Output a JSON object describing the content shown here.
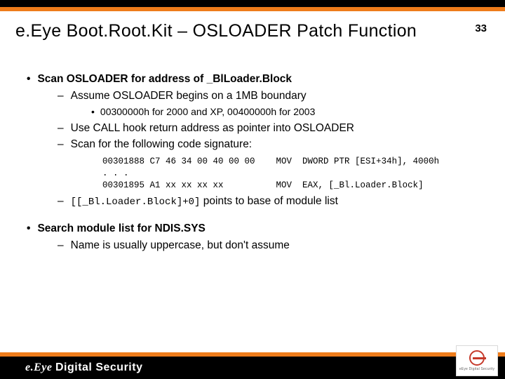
{
  "slide_number": "33",
  "title": "e.Eye Boot.Root.Kit – OSLOADER Patch Function",
  "bullets": {
    "b1a": "Scan OSLOADER for address of _BlLoader.Block",
    "b2a": "Assume OSLOADER begins on a 1MB boundary",
    "b3a": "00300000h for 2000 and XP, 00400000h for 2003",
    "b2b": "Use CALL hook return address as pointer into OSLOADER",
    "b2c": "Scan for the following code signature:",
    "code": "00301888 C7 46 34 00 40 00 00    MOV  DWORD PTR [ESI+34h], 4000h\n. . .\n00301895 A1 xx xx xx xx          MOV  EAX, [_Bl.Loader.Block]",
    "b2d_mono": "[[_Bl.Loader.Block]+0]",
    "b2d_tail": " points to base of module list",
    "b1b": "Search module list for NDIS.SYS",
    "b2e": "Name is usually uppercase, but don't assume"
  },
  "footer": {
    "brand_italic": "e.Eye ",
    "brand_rest": "Digital Security",
    "logo_caption": "eEye Digital Security"
  }
}
